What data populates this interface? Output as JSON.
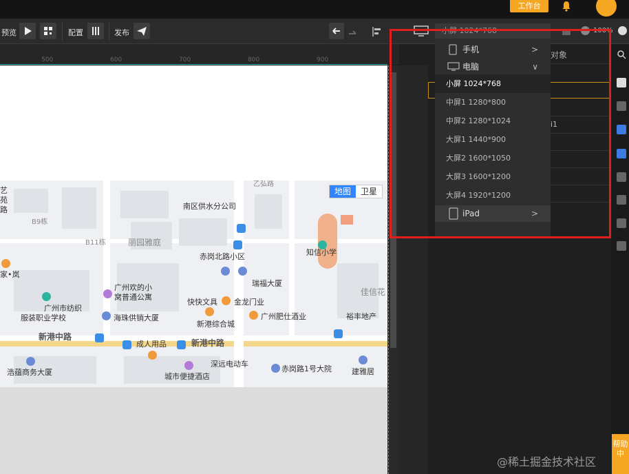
{
  "topbar": {
    "workbench_label": "工作台"
  },
  "toolbar": {
    "preview_label": "预览",
    "config_label": "配置",
    "publish_label": "发布",
    "screen_select_value": "小屏 1024*768",
    "zoom_text": "100%"
  },
  "ruler": {
    "ticks": [
      "500",
      "600",
      "700",
      "800",
      "900"
    ]
  },
  "map": {
    "toggle": {
      "map_label": "地图",
      "satellite_label": "卫星"
    },
    "labels": {
      "yiwu_rd": "乙弘路",
      "nanqu_water": "南区供水分公司",
      "b9": "B9栋",
      "b11": "B11栋",
      "liyuan": "丽园雅庭",
      "chigang_north": "赤岗北路小区",
      "zhixin_school": "知信小学",
      "ruifu": "瑞福大厦",
      "guangzhou_huan": "广州欢的小",
      "guangzhou_huan2": "窝普通公寓",
      "jiaxin": "佳信花",
      "kuaikuai": "快快文具",
      "jinlong": "金龙门业",
      "gz_textile": "广州市纺织",
      "gz_textile2": "服装职业学校",
      "haizhu_store": "海珠供销大厦",
      "xingang_mall": "新港综合城",
      "gz_feishi": "广州肥仕酒业",
      "yuxing": "裕丰地产",
      "xingang_rd_left": "新港中路",
      "chengren": "成人用品",
      "xingang_rd_mid": "新港中路",
      "haoyun": "浩蕴商务大厦",
      "shenyuan": "深远电动车",
      "chigang1": "赤岗路1号大院",
      "jianyaju": "建雅居",
      "city_hotel": "城市便捷酒店",
      "left_cut1": "艺",
      "left_cut2": "苑",
      "left_cut3": "路",
      "left_cut4": "家•岚"
    }
  },
  "right_panel": {
    "object_header": "对象",
    "row_fragment": "i1"
  },
  "dropdown": {
    "groups": [
      {
        "label": "手机",
        "arrow": ">"
      },
      {
        "label": "电脑",
        "arrow": "∨"
      }
    ],
    "items": [
      "小屏 1024*768",
      "中屏1 1280*800",
      "中屏2 1280*1024",
      "大屏1 1440*900",
      "大屏2 1600*1050",
      "大屏3 1600*1200",
      "大屏4 1920*1200"
    ],
    "ipad": {
      "label": "iPad",
      "arrow": ">"
    }
  },
  "help_tab": {
    "label": "帮助中"
  },
  "watermark": "@稀土掘金技术社区",
  "colors": {
    "accent": "#f5a623",
    "highlight_border": "#e01e1e",
    "map_active": "#3385ff"
  }
}
